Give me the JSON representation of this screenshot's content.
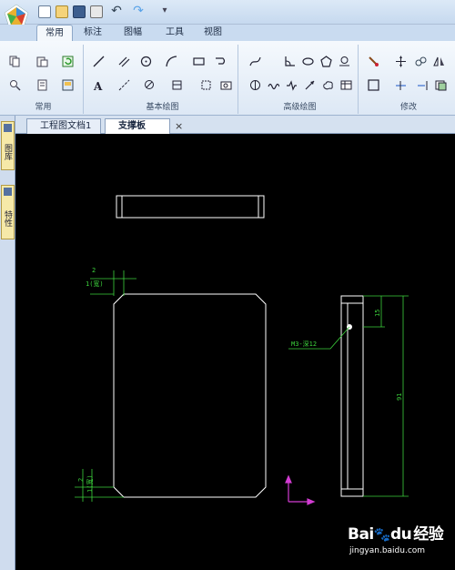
{
  "window": {
    "quick_access": [
      "new-icon",
      "open-icon",
      "save-icon",
      "print-icon",
      "undo-icon",
      "redo-icon"
    ]
  },
  "ribbon": {
    "tabs": [
      {
        "label": "常用",
        "active": true
      },
      {
        "label": "标注",
        "active": false
      },
      {
        "label": "图幅",
        "active": false
      },
      {
        "label": "工具",
        "active": false
      },
      {
        "label": "视图",
        "active": false
      }
    ],
    "groups": [
      {
        "label": "常用"
      },
      {
        "label": "基本绘图"
      },
      {
        "label": "高级绘图"
      },
      {
        "label": "修改"
      }
    ]
  },
  "left_dock": {
    "tabs": [
      {
        "label": "图库"
      },
      {
        "label": "特性"
      }
    ]
  },
  "documents": {
    "tabs": [
      {
        "label": "工程图文档1",
        "active": false
      },
      {
        "label": "支撑板",
        "active": true
      }
    ],
    "close_glyph": "×"
  },
  "drawing": {
    "dimensions": {
      "top_left_thickness": "2",
      "top_left_chamfer": "1(宽)",
      "bottom_left_thickness": "2",
      "bottom_left_chamfer": "1(宽)",
      "right_top": "15",
      "right_height": "91",
      "thread_callout": "M3-深12"
    },
    "colors": {
      "outline": "#ffffff",
      "dimension": "#3cd13c",
      "ucs": "#d23cd2",
      "background": "#000000"
    }
  },
  "watermark": {
    "logo_text_1": "Bai",
    "logo_text_2": "du",
    "logo_text_3": "经验",
    "url": "jingyan.baidu.com"
  }
}
